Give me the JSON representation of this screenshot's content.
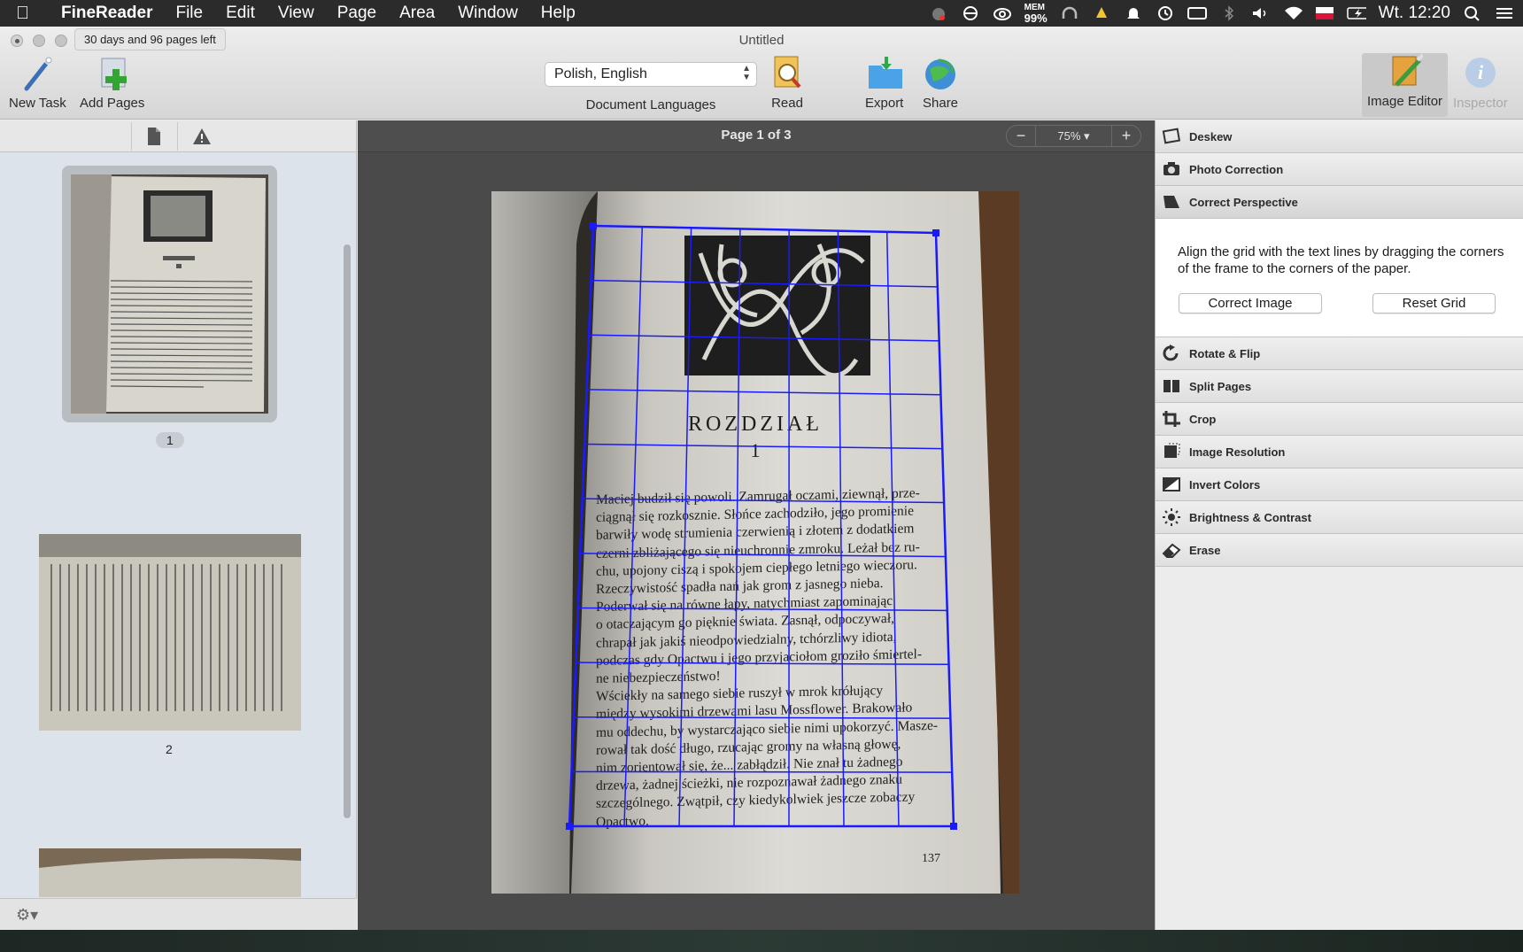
{
  "menubar": {
    "app_name": "FineReader",
    "menus": [
      "File",
      "Edit",
      "View",
      "Page",
      "Area",
      "Window",
      "Help"
    ],
    "mem_label": "MEM",
    "mem_value": "99%",
    "clock": "Wt. 12:20"
  },
  "window": {
    "title": "Untitled",
    "trial_badge": "30 days and 96 pages left"
  },
  "toolbar": {
    "new_task": "New Task",
    "add_pages": "Add Pages",
    "language_value": "Polish, English",
    "language_caption": "Document Languages",
    "read": "Read",
    "export": "Export",
    "share": "Share",
    "image_editor": "Image Editor",
    "inspector": "Inspector"
  },
  "pages_panel": {
    "pages": [
      {
        "label": "1",
        "selected": true
      },
      {
        "label": "2",
        "selected": false
      }
    ]
  },
  "viewer": {
    "page_status": "Page 1 of 3",
    "zoom": "75%",
    "zoom_out": "−",
    "zoom_in": "+",
    "document": {
      "heading": "ROZDZIAŁ",
      "chapter_number": "1",
      "page_number": "137",
      "lines": [
        "Maciej budził się powoli. Zamrugał oczami, ziewnął, prze-",
        "ciągnął się rozkosznie. Słońce zachodziło, jego promienie",
        "barwiły wodę strumienia czerwienią i złotem z dodatkiem",
        "czerni zbliżającego się nieuchronnie zmroku. Leżał bez ru-",
        "chu, upojony ciszą i spokojem ciepłego letniego wieczoru.",
        "Rzeczywistość spadła nań jak grom z jasnego nieba.",
        "Poderwał się na równe łapy, natychmiast zapominając",
        "o otaczającym go pięknie świata. Zasnął, odpoczywał,",
        "chrapał jak jakiś nieodpowiedzialny, tchórzliwy idiota,",
        "podczas gdy Opactwu i jego przyjaciołom groziło śmiertel-",
        "ne niebezpieczeństwo!",
        "Wściekły na samego siebie ruszył w mrok krółujący",
        "między wysokimi drzewami lasu Mossflower. Brakowało",
        "mu oddechu, by wystarczająco siebie nimi upokorzyć. Masze-",
        "rował tak dość długo, rzucając gromy na własną głowę,",
        "nim zorientował się, że... zabłądził. Nie znał tu żadnego",
        "drzewa, żadnej ścieżki, nie rozpoznawał żadnego znaku",
        "szczególnego. Zwątpił, czy kiedykolwiek jeszcze zobaczy",
        "Opactwo."
      ]
    }
  },
  "image_editor": {
    "tools_top": [
      {
        "label": "Deskew",
        "icon": "deskew-icon"
      },
      {
        "label": "Photo Correction",
        "icon": "camera-icon"
      },
      {
        "label": "Correct Perspective",
        "icon": "perspective-icon"
      }
    ],
    "perspective": {
      "description": "Align the grid with the text lines by dragging the corners of the frame to the corners of the paper.",
      "correct_button": "Correct Image",
      "reset_button": "Reset Grid"
    },
    "tools_bottom": [
      {
        "label": "Rotate & Flip",
        "icon": "rotate-icon"
      },
      {
        "label": "Split Pages",
        "icon": "split-icon"
      },
      {
        "label": "Crop",
        "icon": "crop-icon"
      },
      {
        "label": "Image Resolution",
        "icon": "resolution-icon"
      },
      {
        "label": "Invert Colors",
        "icon": "invert-icon"
      },
      {
        "label": "Brightness & Contrast",
        "icon": "brightness-icon"
      },
      {
        "label": "Erase",
        "icon": "eraser-icon"
      }
    ]
  },
  "colors": {
    "grid": "#1a1aff",
    "menubar": "#2b2b2c",
    "viewer_bg": "#4a4a4a"
  }
}
